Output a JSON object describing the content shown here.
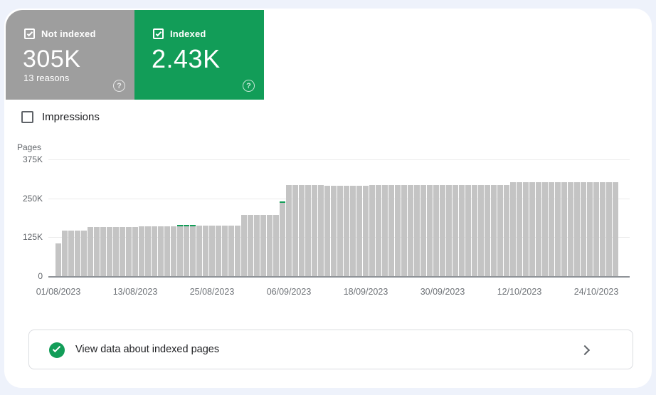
{
  "cards": {
    "not_indexed": {
      "label": "Not indexed",
      "value": "305K",
      "sublabel": "13 reasons",
      "checked": true,
      "color": "#9e9e9e"
    },
    "indexed": {
      "label": "Indexed",
      "value": "2.43K",
      "checked": true,
      "color": "#129d58"
    }
  },
  "icons": {
    "question_mark": "?"
  },
  "impressions_toggle": {
    "label": "Impressions",
    "checked": false
  },
  "chart_data": {
    "type": "bar",
    "title": "Pages",
    "ylabel": "Pages",
    "unit": "K pages",
    "ylim": [
      0,
      375
    ],
    "yticks": [
      375,
      250,
      125,
      0
    ],
    "ytick_labels": [
      "375K",
      "250K",
      "125K",
      "0"
    ],
    "grid": true,
    "x_start_date": "01/08/2023",
    "x_end_date": "27/10/2023",
    "xtick_indices": [
      0,
      12,
      24,
      36,
      48,
      60,
      72,
      84
    ],
    "xtick_labels": [
      "01/08/2023",
      "13/08/2023",
      "25/08/2023",
      "06/09/2023",
      "18/09/2023",
      "30/09/2023",
      "12/10/2023",
      "24/10/2023"
    ],
    "series": [
      {
        "name": "Not indexed",
        "color": "#c4c4c4",
        "values": [
          105,
          147,
          147,
          147,
          147,
          157,
          157,
          157,
          157,
          157,
          157,
          157,
          157,
          159,
          159,
          159,
          159,
          159,
          159,
          160,
          160,
          160,
          163,
          163,
          163,
          163,
          163,
          163,
          163,
          196,
          196,
          196,
          196,
          196,
          196,
          235,
          293,
          293,
          293,
          293,
          293,
          293,
          290,
          290,
          290,
          290,
          290,
          290,
          290,
          292,
          292,
          292,
          292,
          292,
          292,
          292,
          292,
          292,
          292,
          292,
          292,
          292,
          292,
          292,
          292,
          292,
          292,
          292,
          292,
          292,
          292,
          302,
          302,
          302,
          302,
          302,
          302,
          302,
          302,
          302,
          302,
          302,
          302,
          302,
          302,
          302,
          302,
          302
        ]
      },
      {
        "name": "Indexed",
        "color": "#129d58",
        "overlay_points": [
          {
            "index": 19,
            "value": 4
          },
          {
            "index": 20,
            "value": 4
          },
          {
            "index": 21,
            "value": 4
          },
          {
            "index": 35,
            "value": 5
          }
        ]
      }
    ]
  },
  "footer_link": {
    "label": "View data about indexed pages"
  }
}
